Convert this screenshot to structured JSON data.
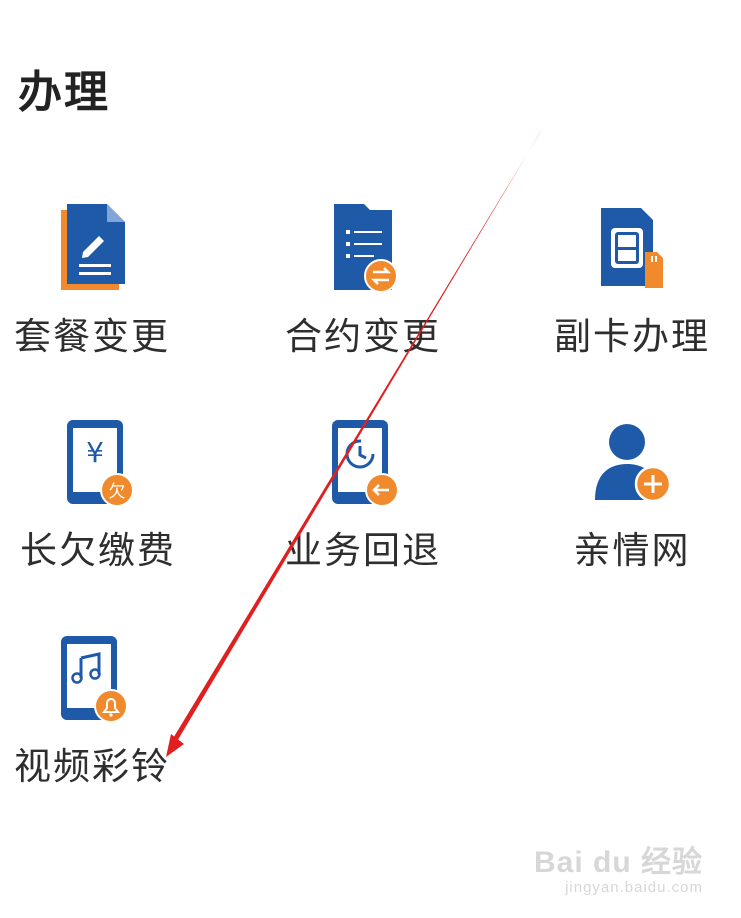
{
  "section": {
    "title": "办理"
  },
  "tiles": [
    {
      "label": "套餐变更",
      "icon": "package-change-icon"
    },
    {
      "label": "合约变更",
      "icon": "contract-change-icon"
    },
    {
      "label": "副卡办理",
      "icon": "sim-card-icon"
    },
    {
      "label": "长欠缴费",
      "icon": "arrears-payment-icon"
    },
    {
      "label": "业务回退",
      "icon": "service-rollback-icon"
    },
    {
      "label": "亲情网",
      "icon": "family-network-icon"
    },
    {
      "label": "视频彩铃",
      "icon": "video-ringtone-icon"
    }
  ],
  "icon_glyphs": {
    "yen": "¥",
    "owe": "欠"
  },
  "colors": {
    "primary": "#1e5aa8",
    "accent": "#f08a2c",
    "arrow": "#e02020"
  },
  "watermark": {
    "logo": "Bai du 经验",
    "sub": "jingyan.baidu.com"
  }
}
